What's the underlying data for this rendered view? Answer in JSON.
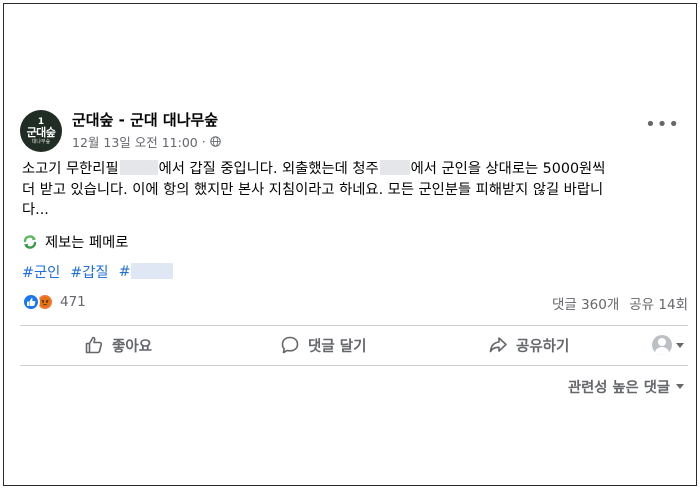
{
  "post": {
    "page_name": "군대숲 - 군대 대나무숲",
    "timestamp": "12월 13일 오전 11:00",
    "separator": "·",
    "avatar": {
      "num": "1",
      "main": "군대숲",
      "sub": "대나무숲"
    },
    "more_icon": "more-horizontal-icon",
    "body": {
      "line1_a": "소고기 무한리필",
      "line1_b": "에서 갑질 중입니다. 외출했는데 청주",
      "line1_c": "에서 군인을 상대로는 5000원씩",
      "line2": "더 받고 있습니다. 이에 항의 했지만 본사 지침이라고 하네요. 모든 군인분들 피해받지 않길 바랍니",
      "line3": "다..."
    },
    "tip": "제보는 페메로",
    "hashtags": [
      "#군인",
      "#갑질",
      "#"
    ]
  },
  "stats": {
    "reaction_count": "471",
    "comments": "댓글 360개",
    "shares": "공유 14회"
  },
  "actions": {
    "like": "좋아요",
    "comment": "댓글 달기",
    "share": "공유하기"
  },
  "sort_label": "관련성 높은 댓글",
  "colors": {
    "link": "#216fdb",
    "muted": "#65676b",
    "like_blue": "#1877f2",
    "angry_orange": "#f0793b"
  }
}
